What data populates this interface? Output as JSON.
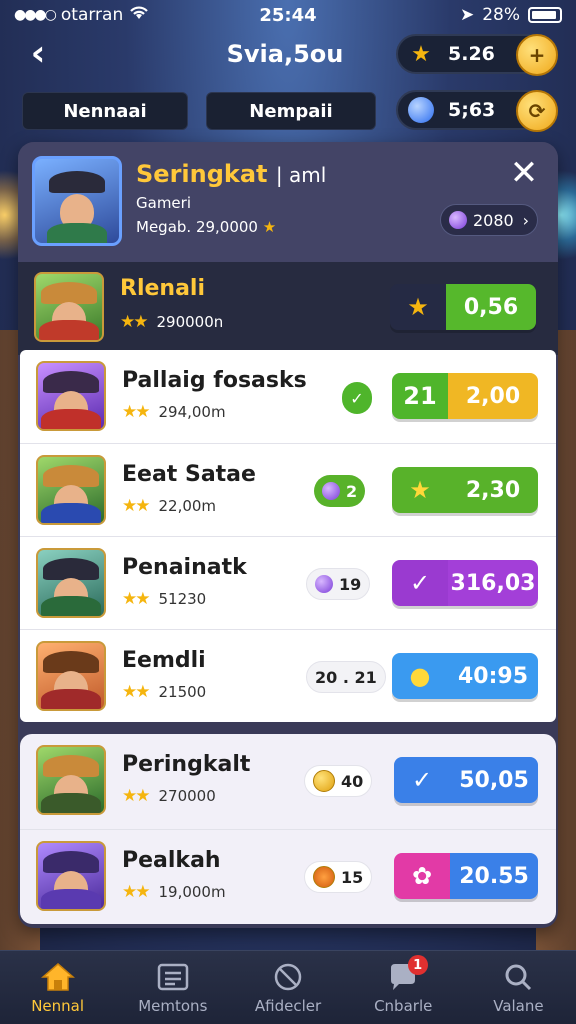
{
  "status_bar": {
    "carrier": "otarran",
    "time": "25:44",
    "battery": "28%"
  },
  "header": {
    "title": "Svia,5ou",
    "tabs": [
      "Nennaai",
      "Nempaii"
    ],
    "currency": [
      {
        "icon": "gold-star-icon",
        "value": "5.26",
        "color": "#f5b50f"
      },
      {
        "icon": "blue-gem-icon",
        "value": "5;63",
        "color": "#3a7bff"
      }
    ]
  },
  "profile": {
    "name": "Seringkat",
    "name_suffix": "| aml",
    "rank": "Gameri",
    "meta": "Megab. 29,0000",
    "gems": "2080"
  },
  "featured": {
    "title": "Rlenali",
    "sub": "290000n",
    "price": "0,56"
  },
  "rows": [
    {
      "title": "Pallaig fosasks",
      "sub": "294,00m",
      "chip": "",
      "btn_a": "21",
      "btn_b": "2,00",
      "color_a": "#4fb52b",
      "color_b": "#f0b724"
    },
    {
      "title": "Eeat Satae",
      "sub": "22,00m",
      "chip": "2",
      "btn_a": "★",
      "btn_b": "2,30",
      "color_a": "#58b22a",
      "color_b": "#58b22a"
    },
    {
      "title": "Penainatk",
      "sub": "51230",
      "chip": "19",
      "btn_a": "✓",
      "btn_b": "316,03",
      "color_a": "#9a3ad0",
      "color_b": "#a33fd8"
    },
    {
      "title": "Eemdli",
      "sub": "21500",
      "chip": "20 . 21",
      "btn_a": "●",
      "btn_b": "40:95",
      "color_a": "#3a9af0",
      "color_b": "#3a9af0"
    },
    {
      "title": "Peringkalt",
      "sub": "270000",
      "chip": "40",
      "btn_a": "✓",
      "btn_b": "50,05",
      "color_a": "#3a80e8",
      "color_b": "#3a80e8"
    },
    {
      "title": "Pealkah",
      "sub": "19,000m",
      "chip": "15",
      "btn_a": "✿",
      "btn_b": "20.55",
      "color_a": "#e23aa6",
      "color_b": "#3a80e8"
    }
  ],
  "nav": [
    {
      "label": "Nennal",
      "icon": "home-icon"
    },
    {
      "label": "Memtons",
      "icon": "list-icon"
    },
    {
      "label": "Afidecler",
      "icon": "target-icon"
    },
    {
      "label": "Cnbarle",
      "icon": "chat-icon",
      "badge": "1"
    },
    {
      "label": "Valane",
      "icon": "search-icon"
    }
  ]
}
